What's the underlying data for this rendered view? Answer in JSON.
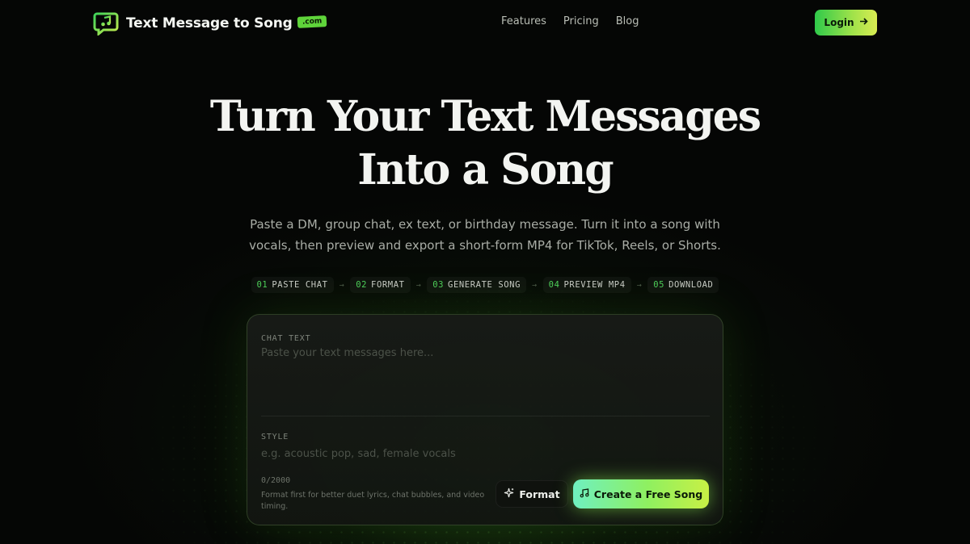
{
  "brand": {
    "name": "Text Message to Song",
    "badge": ".com",
    "accent": "#5fd43a"
  },
  "nav": {
    "links": [
      "Features",
      "Pricing",
      "Blog"
    ],
    "login_label": "Login",
    "login_icon": "arrow-right-icon"
  },
  "hero": {
    "title_line1": "Turn Your Text Messages",
    "title_line2": "Into a Song",
    "subtitle_line1": "Paste a DM, group chat, ex text, or birthday message. Turn it into a song with",
    "subtitle_line2": "vocals, then preview and export a short-form MP4 for TikTok, Reels, or Shorts."
  },
  "steps": [
    {
      "num": "01",
      "label": "PASTE CHAT"
    },
    {
      "num": "02",
      "label": "FORMAT"
    },
    {
      "num": "03",
      "label": "GENERATE SONG"
    },
    {
      "num": "04",
      "label": "PREVIEW MP4"
    },
    {
      "num": "05",
      "label": "DOWNLOAD"
    }
  ],
  "form": {
    "chat_label": "CHAT TEXT",
    "chat_placeholder": "Paste your text messages here...",
    "chat_value": "",
    "style_label": "STYLE",
    "style_placeholder": "e.g. acoustic pop, sad, female vocals",
    "style_value": "",
    "counter": "0/2000",
    "hint": "Format first for better duet lyrics, chat bubbles, and video timing.",
    "format_label": "Format",
    "format_icon": "sparkle-icon",
    "create_label": "Create a Free Song",
    "create_icon": "music-note-icon"
  }
}
